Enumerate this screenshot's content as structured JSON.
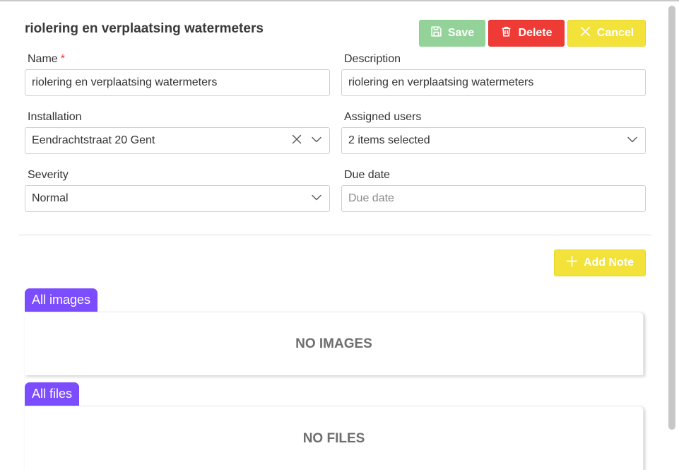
{
  "header": {
    "title": "riolering en verplaatsing watermeters"
  },
  "toolbar": {
    "save_label": "Save",
    "delete_label": "Delete",
    "cancel_label": "Cancel"
  },
  "form": {
    "name": {
      "label": "Name",
      "required_mark": "*",
      "value": "riolering en verplaatsing watermeters"
    },
    "description": {
      "label": "Description",
      "value": "riolering en verplaatsing watermeters"
    },
    "installation": {
      "label": "Installation",
      "value": "Eendrachtstraat 20 Gent"
    },
    "assigned_users": {
      "label": "Assigned users",
      "value": "2 items selected"
    },
    "severity": {
      "label": "Severity",
      "value": "Normal"
    },
    "due_date": {
      "label": "Due date",
      "placeholder": "Due date"
    }
  },
  "notes": {
    "add_note_label": "Add Note"
  },
  "images": {
    "tab_label": "All images",
    "empty_text": "NO IMAGES"
  },
  "files": {
    "tab_label": "All files",
    "empty_text": "NO FILES"
  },
  "colors": {
    "save": "#93d399",
    "delete": "#ef3b36",
    "cancel": "#f2e23a",
    "tab": "#7c4dff",
    "required": "#e53935"
  },
  "icons": {
    "save": "floppy-disk-icon",
    "delete": "trash-icon",
    "cancel": "close-icon",
    "add_note": "plus-icon",
    "clear": "clear-icon",
    "dropdown": "chevron-down-icon"
  }
}
